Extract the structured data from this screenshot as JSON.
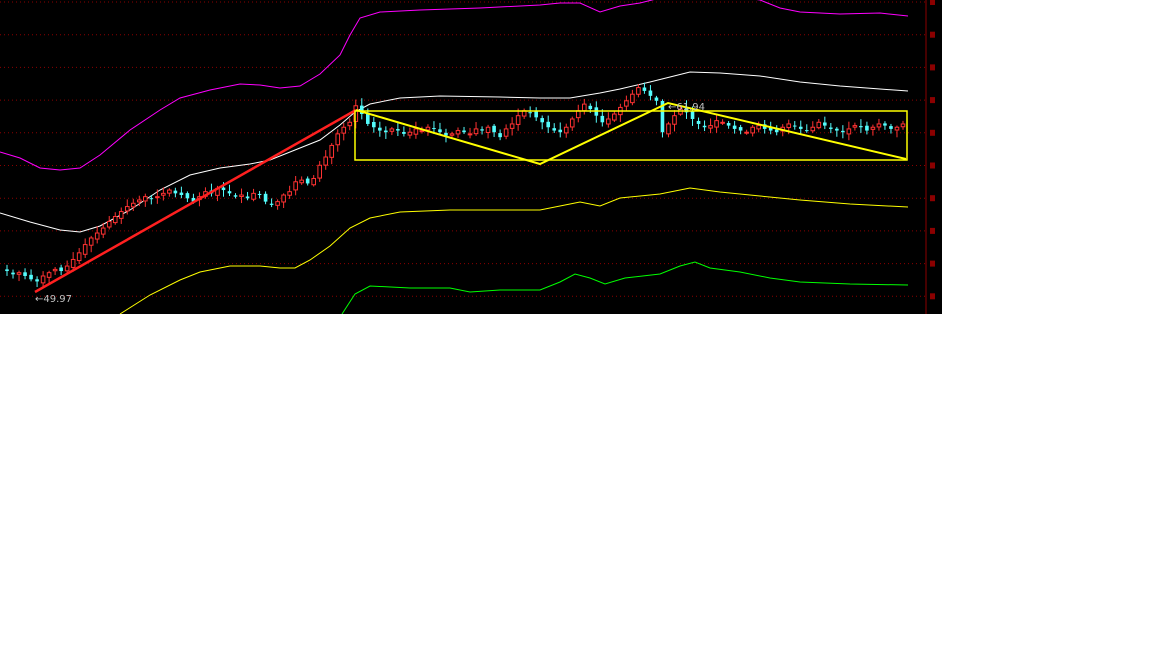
{
  "chart_data": {
    "type": "candlestick",
    "title": "",
    "xlabel": "",
    "ylabel": "",
    "ylim": [
      48,
      67
    ],
    "grid": true,
    "grid_style": "dotted red horizontal",
    "right_axis_tick_labels_legible": false,
    "colors": {
      "background": "#000000",
      "grid": "#8b0000",
      "up_candle": "#ff3232",
      "down_candle": "#54fcfc",
      "trend_line": "#ff2020",
      "pattern_lines": "#ffff00",
      "band_outer_upper": "#ff00ff",
      "band_inner_upper": "#ffffff",
      "band_inner_lower": "#ffff00",
      "band_outer_lower": "#00ff00"
    },
    "annotations": [
      {
        "text": "←49.97",
        "value": 49.97,
        "kind": "low marker"
      },
      {
        "text": "←61.94",
        "value": 61.94,
        "kind": "high marker"
      }
    ],
    "closes": [
      50.6,
      50.4,
      50.5,
      50.3,
      50.1,
      49.97,
      50.3,
      50.5,
      50.7,
      50.6,
      50.9,
      51.3,
      51.7,
      52.2,
      52.6,
      52.9,
      53.2,
      53.6,
      53.9,
      54.2,
      54.5,
      54.7,
      54.9,
      55.1,
      55.0,
      55.1,
      55.3,
      55.5,
      55.3,
      55.2,
      55.0,
      54.8,
      55.1,
      55.4,
      55.3,
      55.6,
      55.5,
      55.3,
      55.1,
      55.2,
      55.0,
      55.3,
      55.2,
      54.8,
      54.6,
      54.8,
      55.2,
      55.4,
      56.0,
      56.1,
      55.9,
      56.2,
      57.0,
      57.5,
      58.2,
      58.9,
      59.3,
      59.6,
      60.6,
      60.1,
      59.5,
      59.3,
      59.1,
      59.0,
      59.2,
      59.1,
      58.9,
      59.0,
      59.2,
      59.1,
      59.3,
      59.2,
      59.0,
      58.8,
      58.9,
      59.1,
      59.0,
      58.9,
      59.2,
      59.1,
      59.3,
      59.0,
      58.7,
      59.2,
      59.5,
      60.0,
      60.3,
      60.2,
      59.9,
      59.6,
      59.3,
      59.1,
      59.0,
      59.3,
      59.8,
      60.3,
      60.7,
      60.4,
      60.0,
      59.6,
      59.8,
      60.1,
      60.5,
      60.9,
      61.3,
      61.7,
      61.5,
      61.2,
      60.9,
      59.0,
      59.5,
      60.0,
      60.4,
      60.2,
      59.8,
      59.5,
      59.3,
      59.4,
      59.7,
      59.6,
      59.4,
      59.2,
      59.1,
      59.0,
      59.3,
      59.4,
      59.2,
      59.1,
      59.0,
      59.3,
      59.5,
      59.4,
      59.2,
      59.1,
      59.3,
      59.6,
      59.4,
      59.2,
      59.1,
      59.0,
      59.2,
      59.4,
      59.3,
      59.1,
      59.3,
      59.5,
      59.4,
      59.2,
      59.3,
      59.5
    ]
  }
}
